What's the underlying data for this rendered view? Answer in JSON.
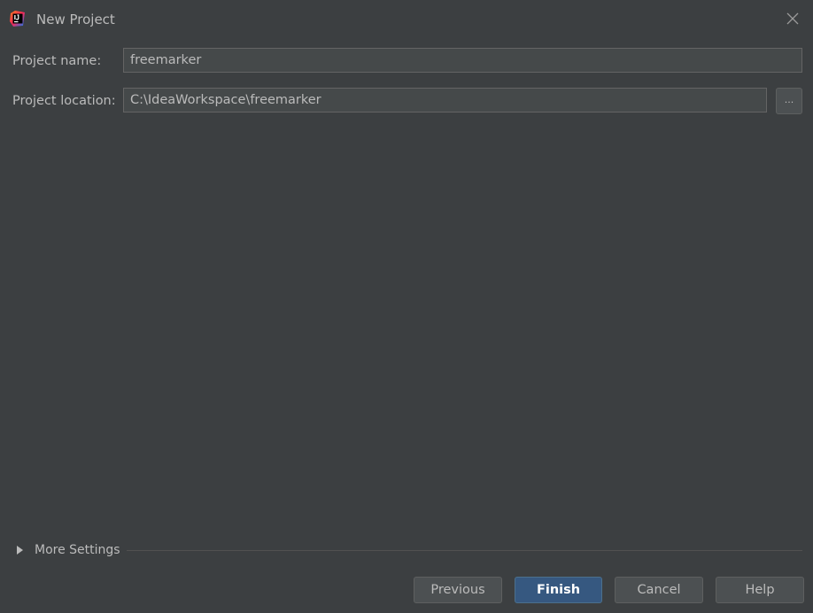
{
  "window": {
    "title": "New Project",
    "app_icon": "intellij-idea-icon",
    "close_icon": "close-icon"
  },
  "form": {
    "project_name_label": "Project name:",
    "project_name_value": "freemarker",
    "project_location_label": "Project location:",
    "project_location_value": "C:\\IdeaWorkspace\\freemarker",
    "browse_label": "..."
  },
  "more_settings": {
    "label": "More Settings",
    "icon": "triangle-right-icon",
    "expanded": false
  },
  "footer": {
    "previous_label": "Previous",
    "finish_label": "Finish",
    "cancel_label": "Cancel",
    "help_label": "Help"
  },
  "colors": {
    "background": "#3c3f41",
    "text": "#bbbbbb",
    "field_background": "#45494a",
    "primary_button": "#365880"
  }
}
